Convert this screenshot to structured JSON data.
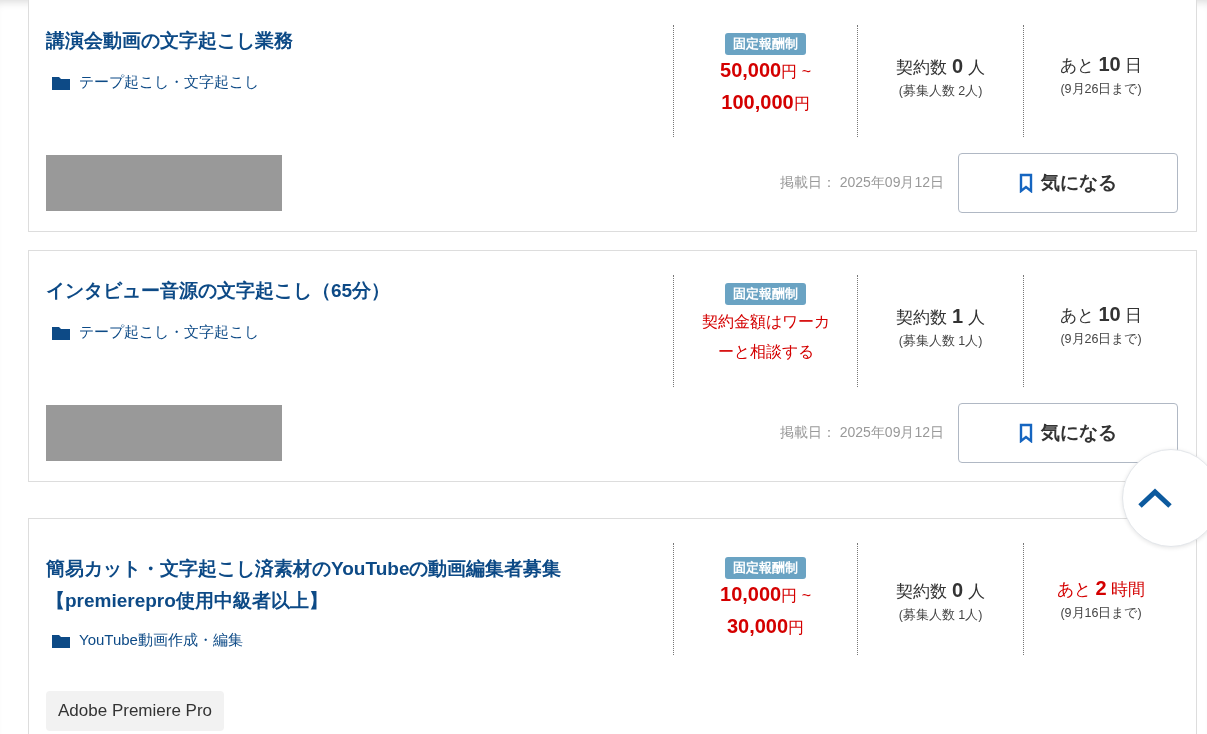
{
  "jobs": [
    {
      "title": "講演会動画の文字起こし業務",
      "category": "テープ起こし・文字起こし",
      "redacted_block": true,
      "pay_type": "固定報酬制",
      "price": {
        "kind": "range",
        "lines": [
          "**50,000**円 ~",
          "**100,000**円"
        ]
      },
      "contracts": "契約数 **0** 人",
      "recruit": "(募集人数 2人)",
      "deadline": "あと **10** 日",
      "urgent": false,
      "deadline_date": "(9月26日まで)",
      "posted": "掲載日： 2025年09月12日",
      "favorite_button": "気になる"
    },
    {
      "title": "インタビュー音源の文字起こし（65分）",
      "category": "テープ起こし・文字起こし",
      "redacted_block": true,
      "pay_type": "固定報酬制",
      "price": {
        "kind": "text",
        "lines": [
          "契約金額はワーカーと相談する"
        ]
      },
      "contracts": "契約数 **1** 人",
      "recruit": "(募集人数 1人)",
      "deadline": "あと **10** 日",
      "urgent": false,
      "deadline_date": "(9月26日まで)",
      "posted": "掲載日： 2025年09月12日",
      "favorite_button": "気になる"
    },
    {
      "title": "簡易カット・文字起こし済素材のYouTubeの動画編集者募集【premierepro使用中級者以上】",
      "category": "YouTube動画作成・編集",
      "skills": [
        "Adobe Premiere Pro"
      ],
      "pay_type": "固定報酬制",
      "price": {
        "kind": "range",
        "lines": [
          "**10,000**円 ~",
          "**30,000**円"
        ]
      },
      "contracts": "契約数 **0** 人",
      "recruit": "(募集人数 1人)",
      "deadline": "あと **2** 時間",
      "urgent": true,
      "deadline_date": "(9月16日まで)"
    }
  ]
}
